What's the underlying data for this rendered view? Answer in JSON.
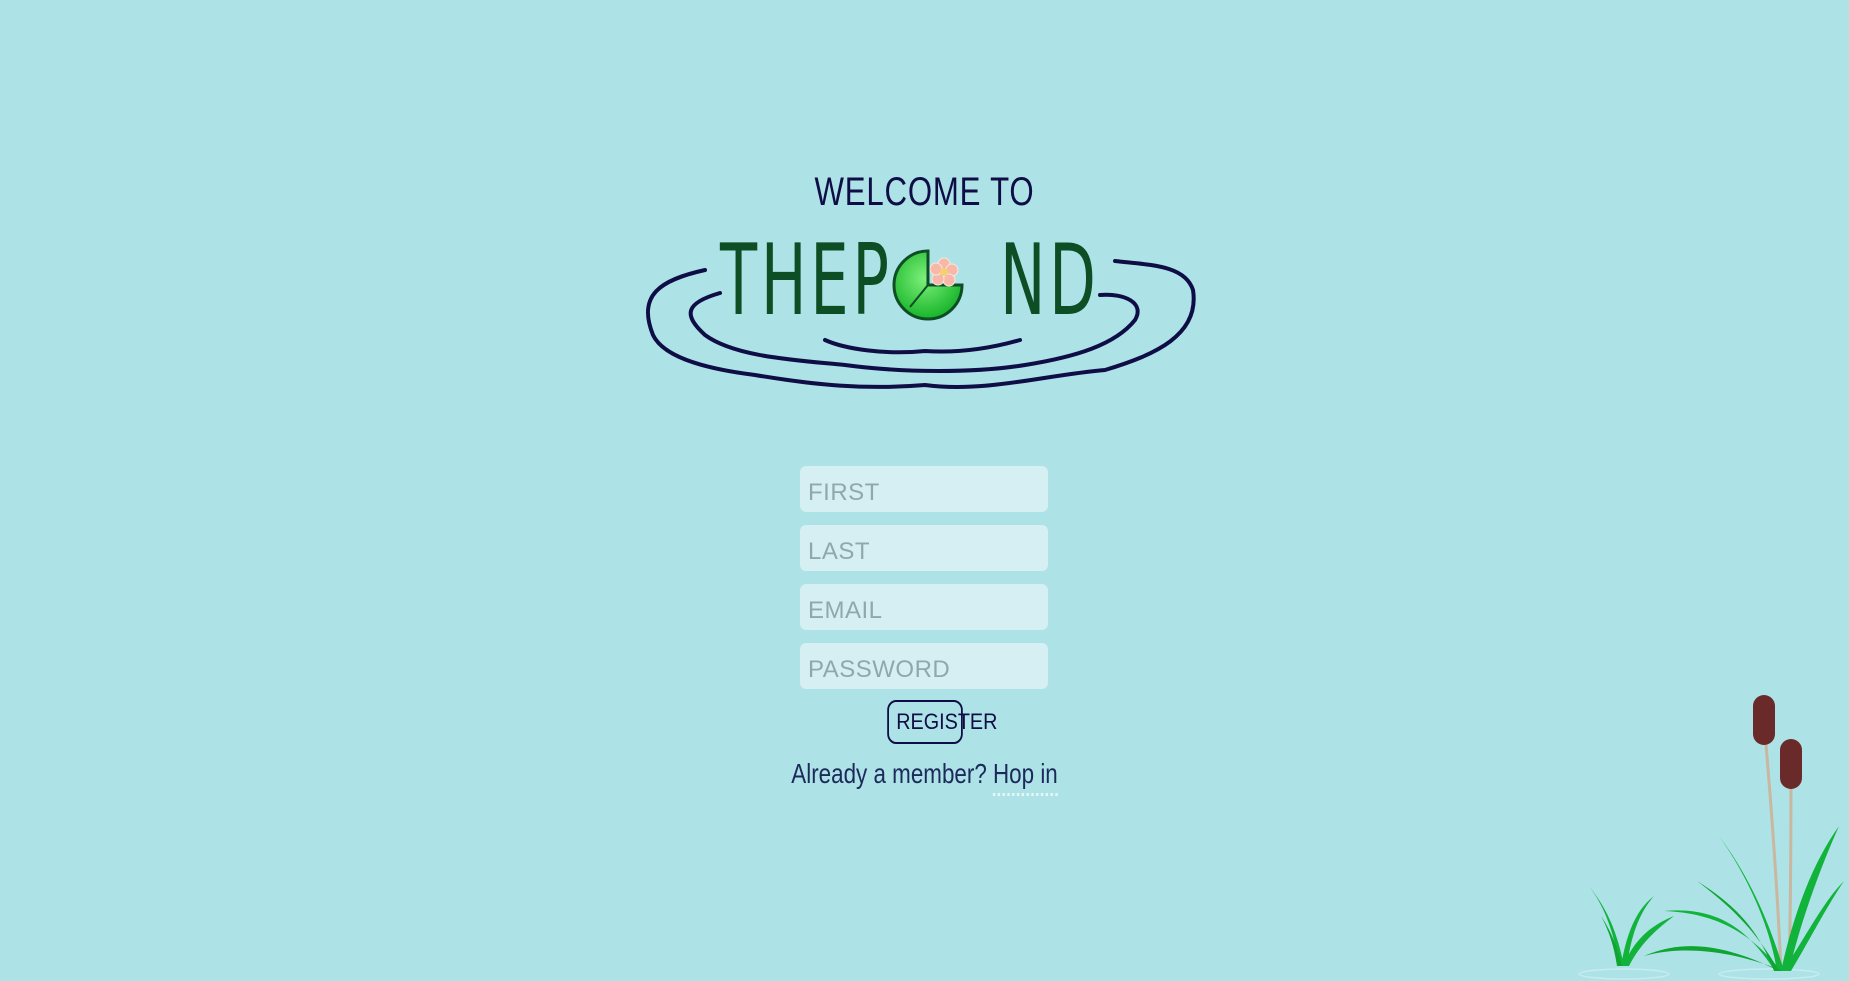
{
  "header": {
    "welcome": "WELCOME TO",
    "logo_text_left": "THEP",
    "logo_text_right": "ND"
  },
  "form": {
    "first_placeholder": "FIRST",
    "last_placeholder": "LAST",
    "email_placeholder": "EMAIL",
    "password_placeholder": "PASSWORD",
    "register_label": "REGISTER"
  },
  "footer": {
    "prompt": "Already a member?",
    "link": "Hop in"
  },
  "colors": {
    "background": "#ade2e7",
    "navy": "#0f0d45",
    "logo_green": "#0e4e25",
    "lilypad_green": "#3ecf3e",
    "cattail_brown": "#6b2a2a",
    "grass_green": "#12b33a"
  },
  "icons": {
    "logo": "pond-lilypad-logo",
    "decor": "cattail-reeds"
  }
}
